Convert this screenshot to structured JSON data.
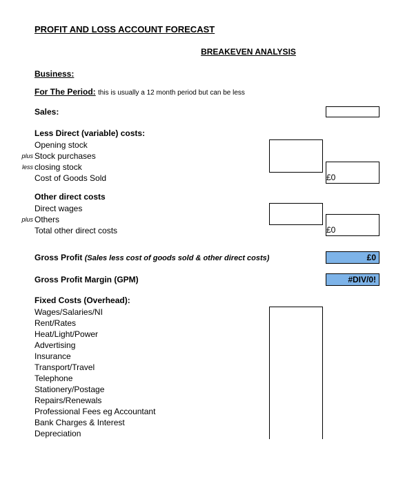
{
  "title": "PROFIT AND LOSS ACCOUNT FORECAST",
  "subtitle": "BREAKEVEN ANALYSIS",
  "business_label": "Business:",
  "period_label": "For The Period:",
  "period_note": "this is usually a 12 month period but can be less",
  "sales_label": "Sales:",
  "direct_costs": {
    "header": "Less Direct (variable) costs:",
    "opening_stock": "Opening stock",
    "stock_purchases": "Stock purchases",
    "closing_stock": "closing stock",
    "cogs": "Cost of Goods Sold",
    "cogs_value": "£0",
    "plus": "plus",
    "less": "less"
  },
  "other_direct": {
    "header": "Other direct costs",
    "direct_wages": "Direct wages",
    "others": "Others",
    "total": "Total other direct costs",
    "total_value": "£0",
    "plus": "plus"
  },
  "gross_profit": {
    "label": "Gross Profit",
    "note": "(Sales less cost of goods sold & other direct costs)",
    "value": "£0"
  },
  "gpm": {
    "label": "Gross Profit Margin (GPM)",
    "value": "#DIV/0!"
  },
  "fixed_costs": {
    "header": "Fixed Costs (Overhead):",
    "items": [
      "Wages/Salaries/NI",
      "Rent/Rates",
      "Heat/Light/Power",
      "Advertising",
      "Insurance",
      "Transport/Travel",
      "Telephone",
      "Stationery/Postage",
      "Repairs/Renewals",
      "Professional Fees eg Accountant",
      "Bank Charges & Interest",
      "Depreciation"
    ]
  }
}
